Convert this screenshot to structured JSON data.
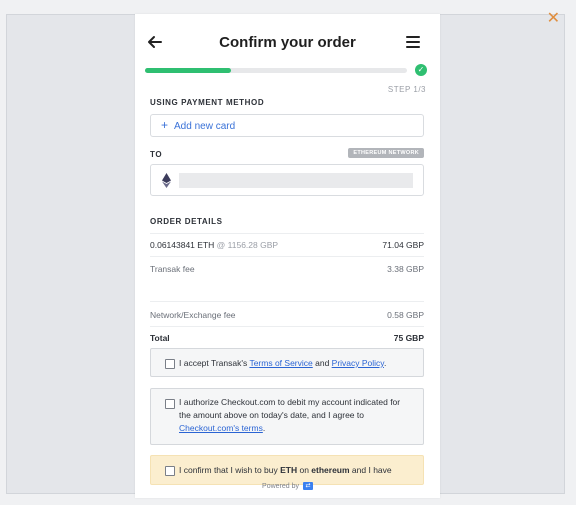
{
  "header": {
    "title": "Confirm your order"
  },
  "progress": {
    "fraction": 0.33,
    "step_label": "STEP 1/3"
  },
  "payment": {
    "section_label": "USING PAYMENT METHOD",
    "add_card_label": "Add new card"
  },
  "recipient": {
    "section_label": "TO",
    "network_badge": "ETHEREUM NETWORK",
    "wallet_address": ""
  },
  "order_details": {
    "section_label": "ORDER DETAILS",
    "rows": [
      {
        "label": "0.06143841 ETH",
        "sub": "@ 1156.28 GBP",
        "value": "71.04 GBP"
      },
      {
        "label": "Transak fee",
        "value": "3.38 GBP"
      },
      {
        "label": "Network/Exchange fee",
        "value": "0.58 GBP"
      },
      {
        "label": "Total",
        "value": "75 GBP"
      }
    ]
  },
  "consents": {
    "terms": {
      "prefix": "I accept Transak's ",
      "tos_link": "Terms of Service",
      "and": " and ",
      "privacy_link": "Privacy Policy",
      "suffix": "."
    },
    "authorize": {
      "text": "I authorize Checkout.com to debit my account indicated for the amount above on today's date, and I agree to ",
      "link": "Checkout.com's terms",
      "suffix": "."
    },
    "confirm": {
      "prefix": "I confirm that I wish to buy ",
      "asset": "ETH",
      "mid": " on ",
      "network": "ethereum",
      "suffix": " and I have"
    }
  },
  "footer": {
    "powered_by": "Powered by"
  },
  "colors": {
    "accent": "#2fbf71",
    "link": "#2a64d4",
    "warning_bg": "#fbeecf",
    "close": "#e08e3e"
  }
}
